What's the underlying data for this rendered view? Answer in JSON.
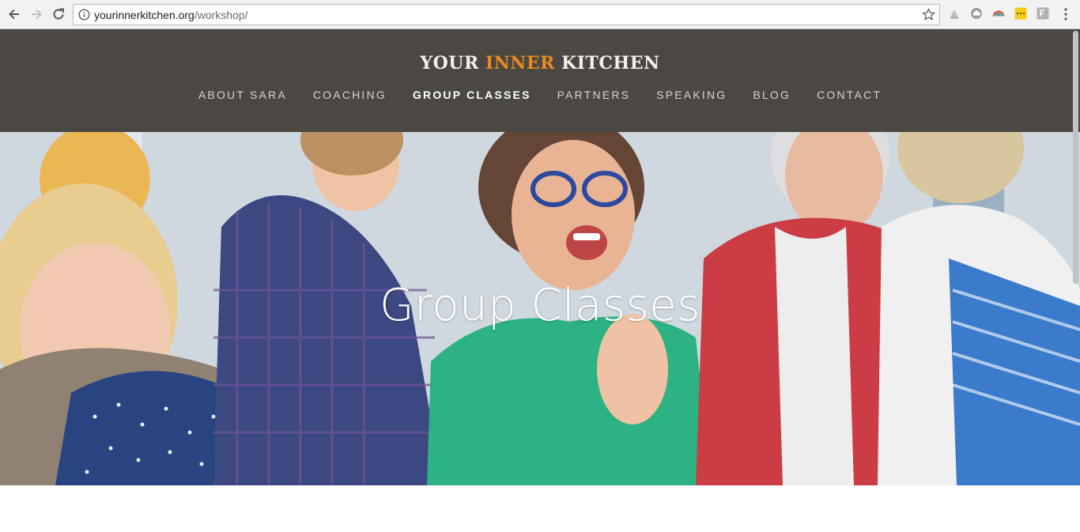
{
  "browser": {
    "url_host": "yourinnerkitchen.org",
    "url_path": "/workshop/"
  },
  "site": {
    "logo": {
      "word1": "YOUR",
      "word2": "INNER",
      "word3": "KITCHEN"
    },
    "nav": [
      {
        "label": "ABOUT SARA"
      },
      {
        "label": "COACHING"
      },
      {
        "label": "GROUP CLASSES"
      },
      {
        "label": "PARTNERS"
      },
      {
        "label": "SPEAKING"
      },
      {
        "label": "BLOG"
      },
      {
        "label": "CONTACT"
      }
    ],
    "active_nav": "GROUP CLASSES"
  },
  "hero": {
    "title": "Group Classes"
  },
  "colors": {
    "header_bg": "#4b4844",
    "logo_accent": "#e88a1e",
    "nav_text": "#d7d2cb",
    "nav_active": "#ffffff"
  }
}
